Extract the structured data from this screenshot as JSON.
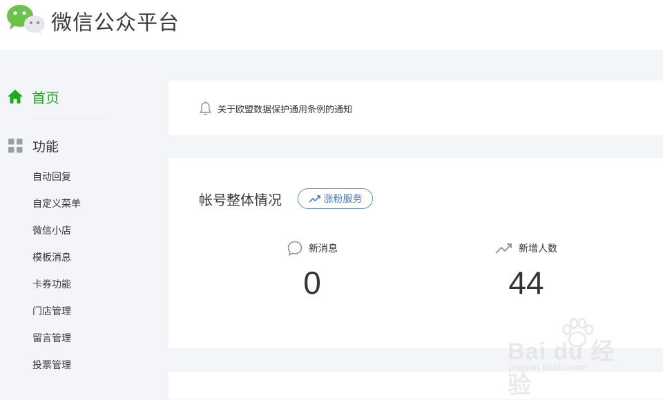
{
  "header": {
    "brand": "微信公众平台",
    "logo_icon": "wechat-logo-icon"
  },
  "sidebar": {
    "home": {
      "label": "首页",
      "icon": "home-icon",
      "color": "#1aad19"
    },
    "functions": {
      "label": "功能",
      "icon": "grid-icon"
    },
    "items": [
      {
        "label": "自动回复"
      },
      {
        "label": "自定义菜单"
      },
      {
        "label": "微信小店"
      },
      {
        "label": "模板消息"
      },
      {
        "label": "卡券功能"
      },
      {
        "label": "门店管理"
      },
      {
        "label": "留言管理"
      },
      {
        "label": "投票管理"
      }
    ]
  },
  "notice": {
    "icon": "bell-icon",
    "text": "关于欧盟数据保护通用条例的通知"
  },
  "overview": {
    "title": "帐号整体情况",
    "growth_button": "涨粉服务",
    "stats": [
      {
        "label": "新消息",
        "value": "0",
        "icon": "chat-bubble-icon"
      },
      {
        "label": "新增人数",
        "value": "44",
        "icon": "trend-up-icon"
      }
    ]
  },
  "watermark": {
    "main": "Bai du 经验",
    "sub": "jingyan.baidu.com"
  },
  "colors": {
    "accent_green": "#1aad19",
    "link_blue": "#3f7cc6",
    "background": "#f4f5f9"
  }
}
